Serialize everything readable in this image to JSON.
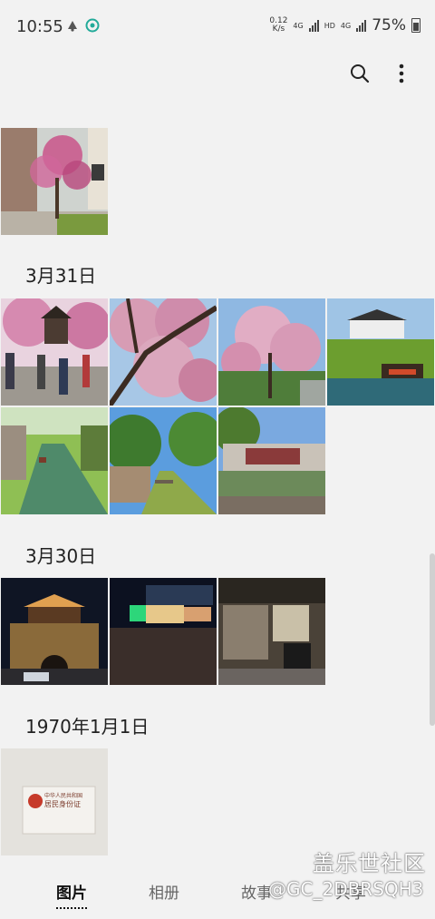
{
  "status_bar": {
    "time": "10:55",
    "net_speed_value": "0.12",
    "net_speed_unit": "K/s",
    "network_1": "4G",
    "hd_label": "HD",
    "network_2": "4G",
    "battery": "75%"
  },
  "toolbar": {
    "search_icon": "search-icon",
    "more_icon": "more-vertical-icon"
  },
  "sections": [
    {
      "date": "",
      "photos": [
        {
          "desc": "blossom-street"
        }
      ]
    },
    {
      "date": "3月31日",
      "photos": [
        {
          "desc": "crowd-blossom"
        },
        {
          "desc": "blossom-branch"
        },
        {
          "desc": "blossom-tree"
        },
        {
          "desc": "canal-boat"
        },
        {
          "desc": "canal-1"
        },
        {
          "desc": "canal-2"
        },
        {
          "desc": "riverside-buildings"
        }
      ]
    },
    {
      "date": "3月30日",
      "photos": [
        {
          "desc": "night-gate"
        },
        {
          "desc": "night-street"
        },
        {
          "desc": "night-shop"
        }
      ]
    },
    {
      "date": "1970年1月1日",
      "photos": [
        {
          "desc": "id-card"
        }
      ]
    }
  ],
  "id_card": {
    "line1": "中华人民共和国",
    "line2": "居民身份证"
  },
  "bottom_nav": {
    "tabs": [
      "图片",
      "相册",
      "故事",
      "共享"
    ],
    "active": "图片"
  },
  "watermark": {
    "logo": "盖乐世社区",
    "user": "@GC_2DBRSQH3"
  },
  "colors": {
    "background": "#f2f2f2",
    "text": "#222222"
  }
}
